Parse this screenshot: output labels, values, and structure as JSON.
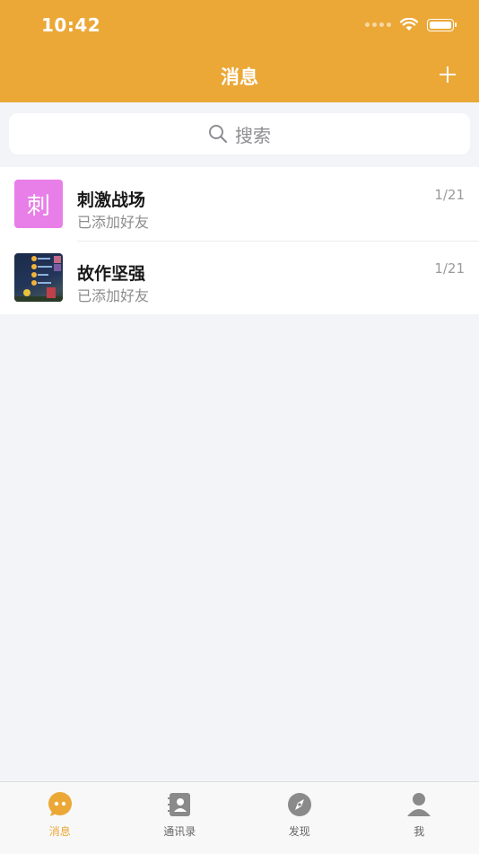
{
  "status_bar": {
    "time": "10:42"
  },
  "header": {
    "title": "消息",
    "add_icon": "plus-icon"
  },
  "search": {
    "placeholder": "搜索",
    "icon": "search-icon"
  },
  "conversations": [
    {
      "avatar_text": "刺",
      "avatar_color": "#e87ee8",
      "name": "刺激战场",
      "preview": "已添加好友",
      "date": "1/21"
    },
    {
      "avatar_text": "",
      "avatar_type": "image",
      "name": "故作坚强",
      "preview": "已添加好友",
      "date": "1/21"
    }
  ],
  "tabbar": {
    "active_color": "#eba837",
    "items": [
      {
        "label": "消息",
        "icon": "chat-bubble-icon",
        "active": true
      },
      {
        "label": "通讯录",
        "icon": "contacts-book-icon",
        "active": false
      },
      {
        "label": "发现",
        "icon": "compass-icon",
        "active": false
      },
      {
        "label": "我",
        "icon": "person-icon",
        "active": false
      }
    ]
  }
}
